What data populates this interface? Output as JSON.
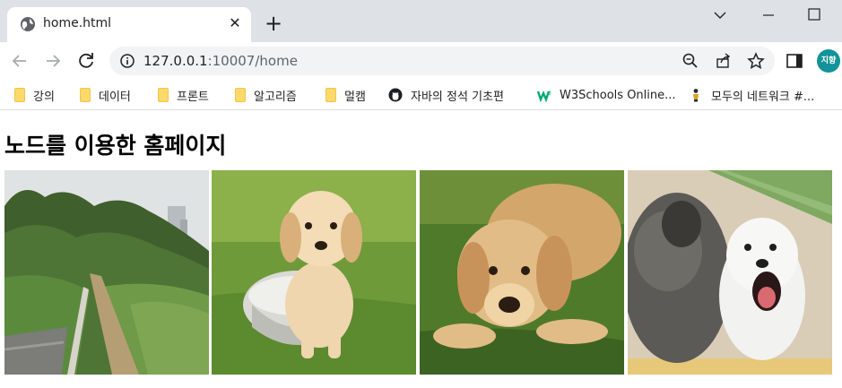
{
  "browser": {
    "tab_title": "home.html",
    "tab_close": "✕",
    "new_tab": "+",
    "url_host": "127.0.0.1",
    "url_path": ":10007/home",
    "avatar_text": "지향",
    "accent": "#12939a"
  },
  "bookmarks": [
    {
      "label": "강의",
      "icon": "folder-icon"
    },
    {
      "label": "데이터",
      "icon": "folder-icon"
    },
    {
      "label": "프론트",
      "icon": "folder-icon"
    },
    {
      "label": "알고리즘",
      "icon": "folder-icon"
    },
    {
      "label": "멀캠",
      "icon": "folder-icon"
    },
    {
      "label": "자바의 정석 기초편",
      "icon": "github-icon"
    },
    {
      "label": "W3Schools Online...",
      "icon": "w3schools-icon"
    },
    {
      "label": "모두의 네트워크 #...",
      "icon": "network-book-icon"
    }
  ],
  "page": {
    "title": "노드를 이용한 홈페이지",
    "images": [
      {
        "name": "forest-park-photo"
      },
      {
        "name": "puppy-in-bowl-photo"
      },
      {
        "name": "puppy-lying-photo"
      },
      {
        "name": "two-puppies-photo"
      }
    ]
  }
}
